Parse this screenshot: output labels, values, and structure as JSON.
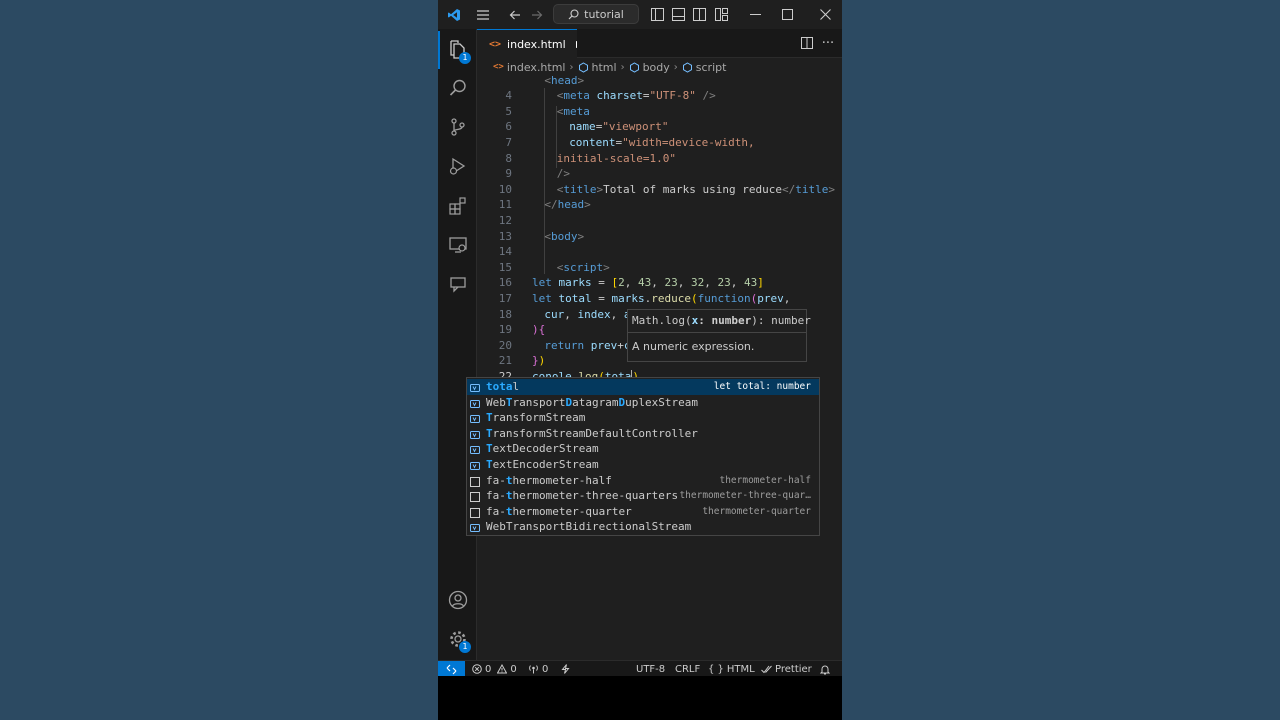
{
  "titlebar": {
    "search_text": "tutorial",
    "icons": [
      "vscode-logo-icon",
      "menu-icon",
      "back-arrow-icon",
      "forward-arrow-icon",
      "search-icon",
      "toggle-primary-sidebar-icon",
      "toggle-panel-icon",
      "toggle-secondary-sidebar-icon",
      "customize-layout-icon",
      "minimize-icon",
      "maximize-icon",
      "close-icon"
    ]
  },
  "activity_bar": {
    "explorer_badge": "1",
    "settings_badge": "1"
  },
  "tab": {
    "file_name": "index.html",
    "glyph": "<>"
  },
  "breadcrumb": {
    "file": "index.html",
    "html": "html",
    "body": "body",
    "script": "script"
  },
  "editor": {
    "lines": [
      {
        "num": "",
        "indent": 1,
        "tokens": [
          [
            "tok-tag",
            "<"
          ],
          [
            "tok-tn",
            "head"
          ],
          [
            "tok-tag",
            ">"
          ]
        ],
        "partial": true
      },
      {
        "num": "4",
        "indent": 2,
        "tokens": [
          [
            "tok-tag",
            "<"
          ],
          [
            "tok-tn",
            "meta"
          ],
          [
            "tok-txt",
            " "
          ],
          [
            "tok-attr",
            "charset"
          ],
          [
            "tok-txt",
            "="
          ],
          [
            "tok-str",
            "\"UTF-8\""
          ],
          [
            "tok-txt",
            " "
          ],
          [
            "tok-tag",
            "/>"
          ]
        ]
      },
      {
        "num": "5",
        "indent": 2,
        "tokens": [
          [
            "tok-tag",
            "<"
          ],
          [
            "tok-tn",
            "meta"
          ]
        ]
      },
      {
        "num": "6",
        "indent": 3,
        "tokens": [
          [
            "tok-attr",
            "name"
          ],
          [
            "tok-txt",
            "="
          ],
          [
            "tok-str",
            "\"viewport\""
          ]
        ]
      },
      {
        "num": "7",
        "indent": 3,
        "tokens": [
          [
            "tok-attr",
            "content"
          ],
          [
            "tok-txt",
            "="
          ],
          [
            "tok-str",
            "\"width=device-width,"
          ]
        ]
      },
      {
        "num": "8",
        "indent": 2,
        "tokens": [
          [
            "tok-str",
            "initial-scale=1.0\""
          ]
        ]
      },
      {
        "num": "9",
        "indent": 2,
        "tokens": [
          [
            "tok-tag",
            "/>"
          ]
        ]
      },
      {
        "num": "10",
        "indent": 2,
        "tokens": [
          [
            "tok-tag",
            "<"
          ],
          [
            "tok-tn",
            "title"
          ],
          [
            "tok-tag",
            ">"
          ],
          [
            "tok-txt",
            "Total of marks using reduce"
          ],
          [
            "tok-tag",
            "</"
          ],
          [
            "tok-tn",
            "title"
          ],
          [
            "tok-tag",
            ">"
          ]
        ]
      },
      {
        "num": "11",
        "indent": 1,
        "tokens": [
          [
            "tok-tag",
            "</"
          ],
          [
            "tok-tn",
            "head"
          ],
          [
            "tok-tag",
            ">"
          ]
        ]
      },
      {
        "num": "12",
        "indent": 0,
        "tokens": []
      },
      {
        "num": "13",
        "indent": 1,
        "tokens": [
          [
            "tok-tag",
            "<"
          ],
          [
            "tok-tn",
            "body"
          ],
          [
            "tok-tag",
            ">"
          ]
        ]
      },
      {
        "num": "14",
        "indent": 0,
        "tokens": []
      },
      {
        "num": "15",
        "indent": 2,
        "tokens": [
          [
            "tok-tag",
            "<"
          ],
          [
            "tok-tn",
            "script"
          ],
          [
            "tok-tag",
            ">"
          ]
        ]
      },
      {
        "num": "16",
        "indent": 0,
        "tokens": [
          [
            "tok-kw",
            "let"
          ],
          [
            "tok-txt",
            " "
          ],
          [
            "tok-var",
            "marks"
          ],
          [
            "tok-txt",
            " = "
          ],
          [
            "tok-br1",
            "["
          ],
          [
            "tok-num",
            "2"
          ],
          [
            "tok-txt",
            ", "
          ],
          [
            "tok-num",
            "43"
          ],
          [
            "tok-txt",
            ", "
          ],
          [
            "tok-num",
            "23"
          ],
          [
            "tok-txt",
            ", "
          ],
          [
            "tok-num",
            "32"
          ],
          [
            "tok-txt",
            ", "
          ],
          [
            "tok-num",
            "23"
          ],
          [
            "tok-txt",
            ", "
          ],
          [
            "tok-num",
            "43"
          ],
          [
            "tok-br1",
            "]"
          ]
        ]
      },
      {
        "num": "17",
        "indent": 0,
        "tokens": [
          [
            "tok-kw",
            "let"
          ],
          [
            "tok-txt",
            " "
          ],
          [
            "tok-var",
            "total"
          ],
          [
            "tok-txt",
            " = "
          ],
          [
            "tok-var",
            "marks"
          ],
          [
            "tok-txt",
            "."
          ],
          [
            "tok-fn",
            "reduce"
          ],
          [
            "tok-br1",
            "("
          ],
          [
            "tok-kw",
            "function"
          ],
          [
            "tok-br2",
            "("
          ],
          [
            "tok-var",
            "prev"
          ],
          [
            "tok-txt",
            ","
          ]
        ]
      },
      {
        "num": "18",
        "indent": 1,
        "tokens": [
          [
            "tok-var",
            "cur"
          ],
          [
            "tok-txt",
            ", "
          ],
          [
            "tok-var",
            "index"
          ],
          [
            "tok-txt",
            ", "
          ],
          [
            "tok-var",
            "array"
          ]
        ]
      },
      {
        "num": "19",
        "indent": 0,
        "tokens": [
          [
            "tok-br2",
            ")"
          ],
          [
            "tok-br2",
            "{"
          ]
        ]
      },
      {
        "num": "20",
        "indent": 1,
        "tokens": [
          [
            "tok-kw",
            "return"
          ],
          [
            "tok-txt",
            " "
          ],
          [
            "tok-var",
            "prev"
          ],
          [
            "tok-txt",
            "+"
          ],
          [
            "tok-var",
            "cur"
          ]
        ]
      },
      {
        "num": "21",
        "indent": 0,
        "tokens": [
          [
            "tok-br2",
            "}"
          ],
          [
            "tok-br1",
            ")"
          ]
        ]
      },
      {
        "num": "22",
        "indent": 0,
        "tokens": [
          [
            "tok-var",
            "conole"
          ],
          [
            "tok-txt",
            "."
          ],
          [
            "tok-fn",
            "log"
          ],
          [
            "tok-br1",
            "("
          ],
          [
            "tok-var",
            "tota"
          ],
          [
            "tok-br1",
            ")"
          ]
        ],
        "active": true
      }
    ]
  },
  "hover": {
    "sig_name": "Math.log(",
    "sig_param": "x",
    "sig_colon": ": ",
    "sig_type": "number",
    "sig_close": "): number",
    "description": "A numeric expression."
  },
  "suggest": {
    "items": [
      {
        "icon": "variable-icon",
        "parts": [
          [
            "hl",
            "tota"
          ],
          [
            "",
            "l"
          ]
        ],
        "detail": "let total: number",
        "selected": true
      },
      {
        "icon": "variable-icon",
        "parts": [
          [
            "hl",
            "T"
          ],
          [
            "",
            "ransport"
          ],
          [
            "hl",
            "D"
          ],
          [
            "",
            "atagram"
          ],
          [
            "hl",
            "D"
          ],
          [
            "",
            "uplexStream"
          ]
        ],
        "prefix": "WebTransportDatagramDuplexStream",
        "detail": ""
      },
      {
        "icon": "variable-icon",
        "parts": [
          [
            "hl",
            "T"
          ],
          [
            "",
            "ransformStream"
          ]
        ],
        "detail": ""
      },
      {
        "icon": "variable-icon",
        "parts": [
          [
            "hl",
            "T"
          ],
          [
            "",
            "ransformStreamDefaultController"
          ]
        ],
        "detail": ""
      },
      {
        "icon": "variable-icon",
        "parts": [
          [
            "hl",
            "T"
          ],
          [
            "",
            "extDecoderStream"
          ]
        ],
        "detail": ""
      },
      {
        "icon": "variable-icon",
        "parts": [
          [
            "hl",
            "T"
          ],
          [
            "",
            "extEncoderStream"
          ]
        ],
        "detail": ""
      },
      {
        "icon": "snippet-icon",
        "parts": [
          [
            "",
            "fa-"
          ],
          [
            "hl",
            "t"
          ],
          [
            "",
            "hermometer-half"
          ]
        ],
        "detail": "thermometer-half"
      },
      {
        "icon": "snippet-icon",
        "parts": [
          [
            "",
            "fa-"
          ],
          [
            "hl",
            "t"
          ],
          [
            "",
            "hermometer-three-quarters"
          ]
        ],
        "detail": "thermometer-three-quar…"
      },
      {
        "icon": "snippet-icon",
        "parts": [
          [
            "",
            "fa-"
          ],
          [
            "hl",
            "t"
          ],
          [
            "",
            "hermometer-quarter"
          ]
        ],
        "detail": "thermometer-quarter"
      },
      {
        "icon": "variable-icon",
        "parts": [
          [
            "",
            "WebTransportBidirectionalStream"
          ]
        ],
        "detail": ""
      }
    ]
  },
  "statusbar": {
    "errors": "0",
    "warnings": "0",
    "ports": "0",
    "encoding": "UTF-8",
    "eol": "CRLF",
    "language": "HTML",
    "formatter": "Prettier"
  }
}
